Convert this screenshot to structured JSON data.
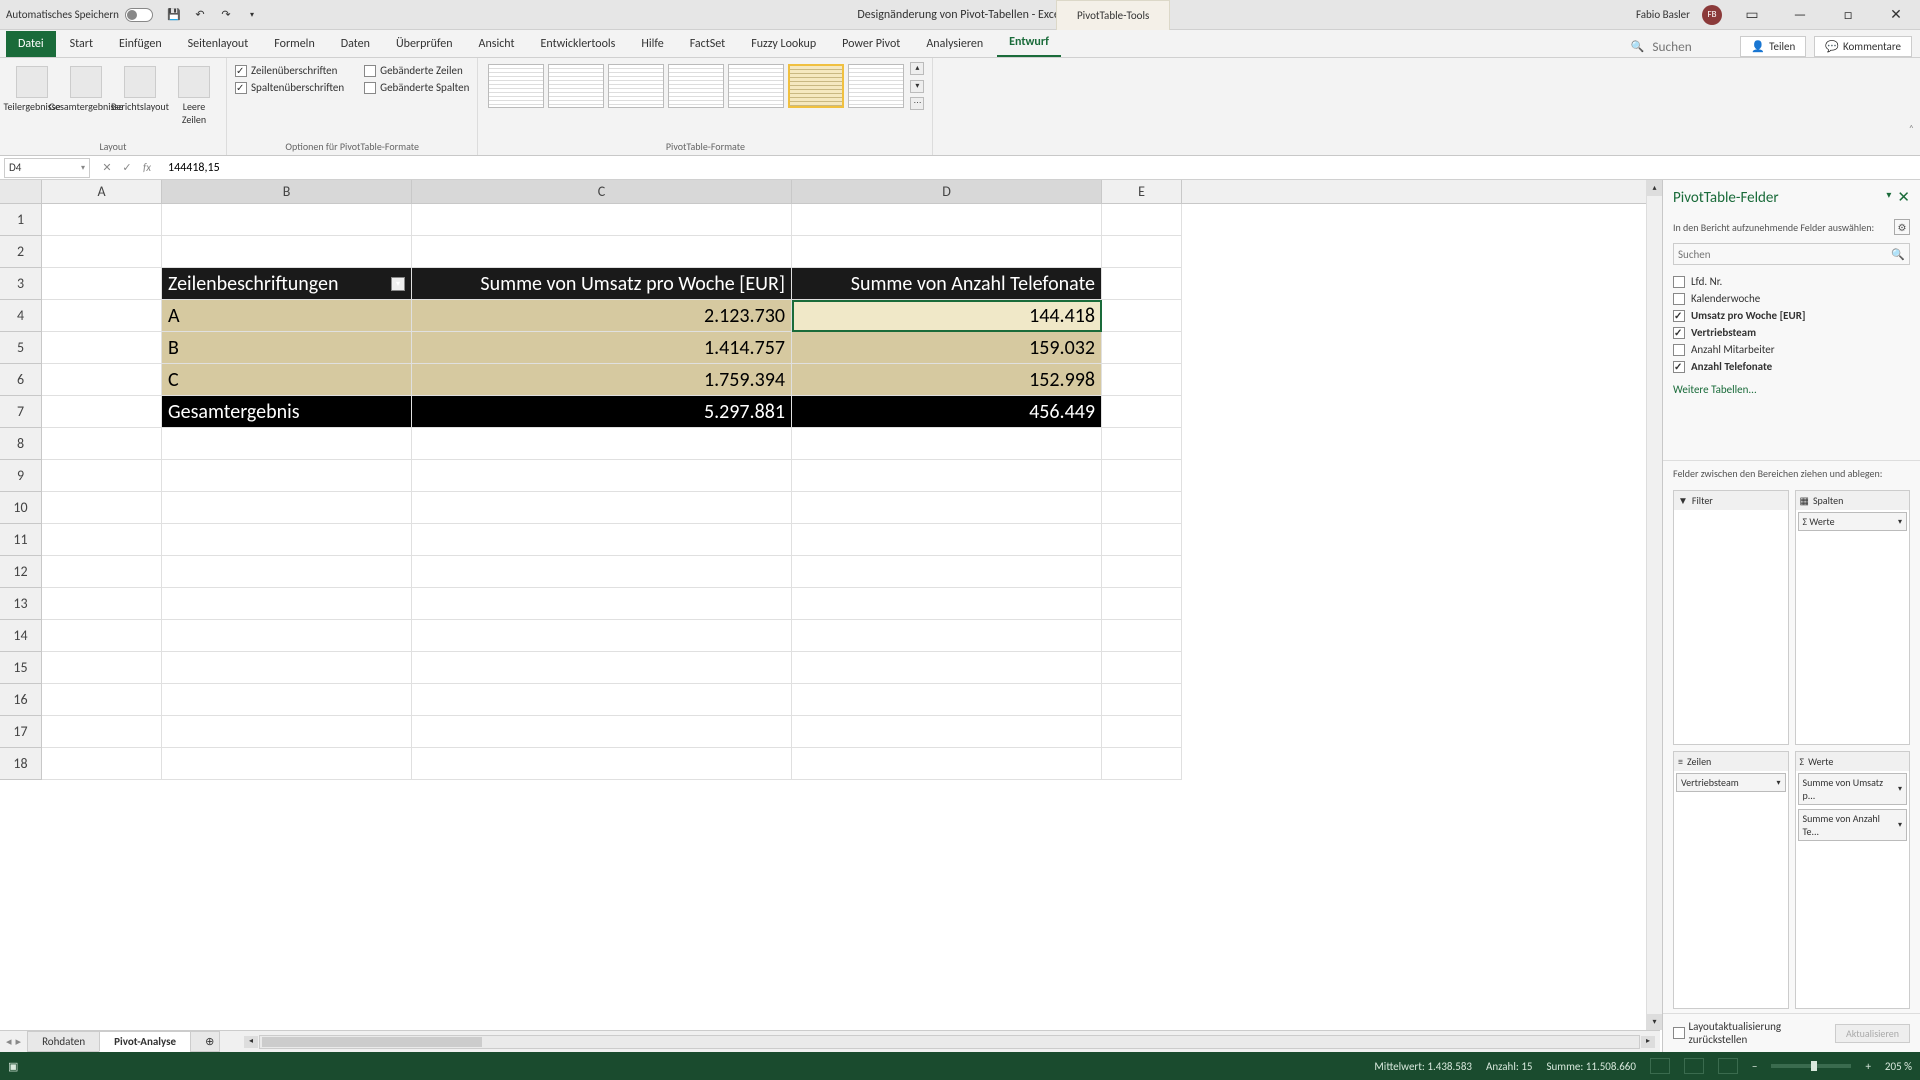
{
  "titlebar": {
    "autosave": "Automatisches Speichern",
    "doc_title": "Designänderung von Pivot-Tabellen - Excel",
    "context_tool": "PivotTable-Tools",
    "user": "Fabio Basler",
    "avatar": "FB"
  },
  "tabs": {
    "file": "Datei",
    "items": [
      "Start",
      "Einfügen",
      "Seitenlayout",
      "Formeln",
      "Daten",
      "Überprüfen",
      "Ansicht",
      "Entwicklertools",
      "Hilfe",
      "FactSet",
      "Fuzzy Lookup",
      "Power Pivot",
      "Analysieren",
      "Entwurf"
    ],
    "active": "Entwurf",
    "search_ph": "Suchen",
    "share": "Teilen",
    "comments": "Kommentare"
  },
  "ribbon": {
    "layout": {
      "subtotals": "Teilergebnisse",
      "grandtotals": "Gesamtergebnisse",
      "report": "Berichtslayout",
      "blank": "Leere Zeilen",
      "label": "Layout"
    },
    "options": {
      "row_headers": "Zeilenüberschriften",
      "col_headers": "Spaltenüberschriften",
      "banded_rows": "Gebänderte Zeilen",
      "banded_cols": "Gebänderte Spalten",
      "label": "Optionen für PivotTable-Formate"
    },
    "styles_label": "PivotTable-Formate"
  },
  "fx": {
    "cell_ref": "D4",
    "value": "144418,15"
  },
  "columns": [
    "A",
    "B",
    "C",
    "D",
    "E"
  ],
  "pivot": {
    "header": {
      "rows": "Zeilenbeschriftungen",
      "c": "Summe von Umsatz pro Woche [EUR]",
      "d": "Summe von Anzahl Telefonate"
    },
    "rows": [
      {
        "label": "A",
        "c": "2.123.730",
        "d": "144.418"
      },
      {
        "label": "B",
        "c": "1.414.757",
        "d": "159.032"
      },
      {
        "label": "C",
        "c": "1.759.394",
        "d": "152.998"
      }
    ],
    "total": {
      "label": "Gesamtergebnis",
      "c": "5.297.881",
      "d": "456.449"
    }
  },
  "pane": {
    "title": "PivotTable-Felder",
    "sub": "In den Bericht aufzunehmende Felder auswählen:",
    "search_ph": "Suchen",
    "fields": [
      {
        "name": "Lfd. Nr.",
        "checked": false
      },
      {
        "name": "Kalenderwoche",
        "checked": false
      },
      {
        "name": "Umsatz pro Woche [EUR]",
        "checked": true
      },
      {
        "name": "Vertriebsteam",
        "checked": true
      },
      {
        "name": "Anzahl Mitarbeiter",
        "checked": false
      },
      {
        "name": "Anzahl Telefonate",
        "checked": true
      }
    ],
    "more_tables": "Weitere Tabellen...",
    "drag_label": "Felder zwischen den Bereichen ziehen und ablegen:",
    "areas": {
      "filter": "Filter",
      "columns": "Spalten",
      "rows": "Zeilen",
      "values": "Werte",
      "col_items": [
        "Σ Werte"
      ],
      "row_items": [
        "Vertriebsteam"
      ],
      "val_items": [
        "Summe von Umsatz p...",
        "Summe von Anzahl Te..."
      ]
    },
    "defer": "Layoutaktualisierung zurückstellen",
    "update": "Aktualisieren"
  },
  "sheets": {
    "items": [
      "Rohdaten",
      "Pivot-Analyse"
    ],
    "active": "Pivot-Analyse"
  },
  "status": {
    "avg_lbl": "Mittelwert:",
    "avg": "1.438.583",
    "count_lbl": "Anzahl:",
    "count": "15",
    "sum_lbl": "Summe:",
    "sum": "11.508.660",
    "zoom": "205 %"
  },
  "chart_data": {
    "type": "table",
    "title": "PivotTable",
    "columns": [
      "Zeilenbeschriftungen",
      "Summe von Umsatz pro Woche [EUR]",
      "Summe von Anzahl Telefonate"
    ],
    "rows": [
      [
        "A",
        2123730,
        144418
      ],
      [
        "B",
        1414757,
        159032
      ],
      [
        "C",
        1759394,
        152998
      ]
    ],
    "totals": [
      "Gesamtergebnis",
      5297881,
      456449
    ]
  }
}
